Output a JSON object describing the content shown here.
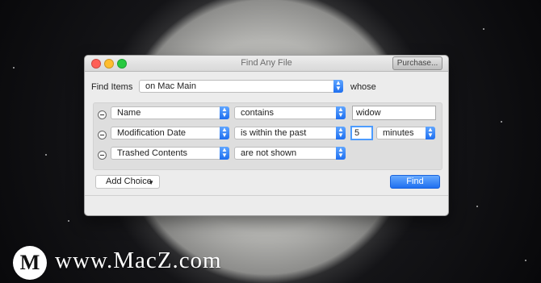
{
  "window": {
    "title": "Find Any File",
    "purchase_label": "Purchase..."
  },
  "search": {
    "find_items_label": "Find Items",
    "location": "on Mac Main",
    "whose_label": "whose"
  },
  "criteria": [
    {
      "field": "Name",
      "operator": "contains",
      "value": "widow"
    },
    {
      "field": "Modification Date",
      "operator": "is within the past",
      "value": "5",
      "unit": "minutes"
    },
    {
      "field": "Trashed Contents",
      "operator": "are not shown"
    }
  ],
  "actions": {
    "add_choice_label": "Add Choice",
    "find_label": "Find"
  },
  "watermark": {
    "text": "www.MacZ.com",
    "logo_letter": "M"
  },
  "colors": {
    "accent": "#1f6ff0",
    "window_bg": "#ececec"
  },
  "icons": {
    "remove": "remove-criterion-icon",
    "dropdown": "dropdown-arrows-icon",
    "chevron": "chevron-down-icon"
  }
}
